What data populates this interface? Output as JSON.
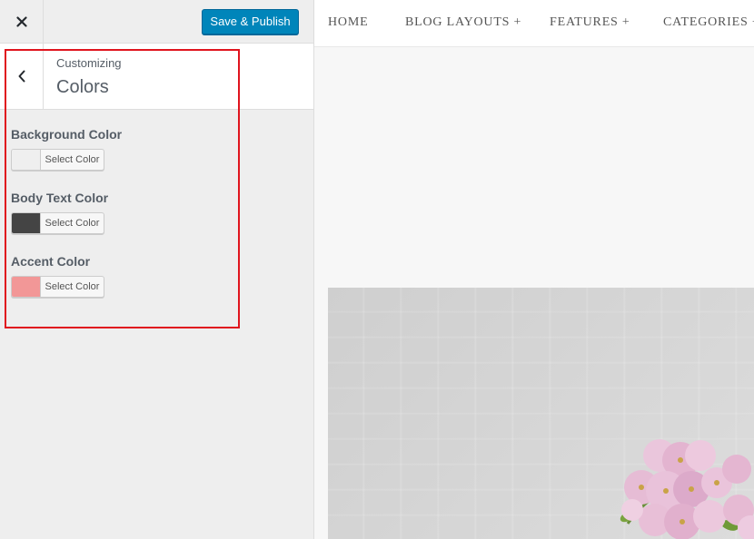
{
  "topbar": {
    "close_icon": "close-icon",
    "save_label": "Save & Publish",
    "save_color": "#0085ba"
  },
  "section": {
    "back_icon": "chevron-left-icon",
    "subtitle": "Customizing",
    "title": "Colors"
  },
  "controls": [
    {
      "label": "Background Color",
      "button": "Select Color",
      "swatch": "#efefef"
    },
    {
      "label": "Body Text Color",
      "button": "Select Color",
      "swatch": "#444444"
    },
    {
      "label": "Accent Color",
      "button": "Select Color",
      "swatch": "#f29797"
    }
  ],
  "highlight_color": "#e0141e",
  "site_nav": {
    "items": [
      "HOME",
      "BLOG LAYOUTS +",
      "FEATURES +",
      "CATEGORIES +"
    ]
  }
}
